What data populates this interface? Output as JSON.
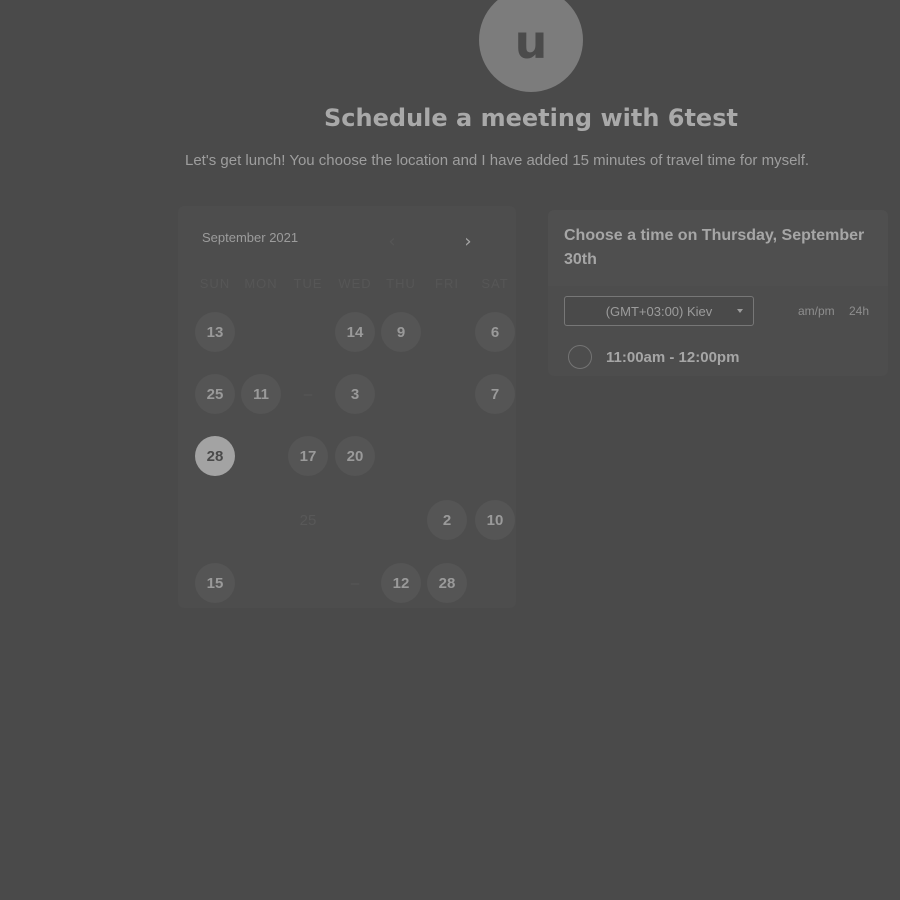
{
  "avatar": {
    "initial": "u"
  },
  "header": {
    "title": "Schedule a meeting with 6test",
    "subtitle": "Let's get lunch! You choose the location and I have added 15 minutes of travel time for myself."
  },
  "calendar": {
    "month_label": "September 2021",
    "prev_icon": "chevron-left-icon",
    "next_icon": "chevron-right-icon",
    "weekdays": [
      "SUN",
      "MON",
      "TUE",
      "WED",
      "THU",
      "FRI",
      "SAT"
    ],
    "days": [
      {
        "label": "13",
        "state": "available",
        "row": 0,
        "col": 0
      },
      {
        "label": "14",
        "state": "available",
        "row": 0,
        "col": 3
      },
      {
        "label": "9",
        "state": "available",
        "row": 0,
        "col": 4
      },
      {
        "label": "6",
        "state": "available",
        "row": 0,
        "col": 6
      },
      {
        "label": "25",
        "state": "available",
        "row": 1,
        "col": 0
      },
      {
        "label": "11",
        "state": "available",
        "row": 1,
        "col": 1
      },
      {
        "label": "–",
        "state": "unavailable",
        "row": 1,
        "col": 2
      },
      {
        "label": "3",
        "state": "available",
        "row": 1,
        "col": 3
      },
      {
        "label": "7",
        "state": "available",
        "row": 1,
        "col": 6
      },
      {
        "label": "28",
        "state": "selected",
        "row": 2,
        "col": 0
      },
      {
        "label": "17",
        "state": "available",
        "row": 2,
        "col": 2
      },
      {
        "label": "20",
        "state": "available",
        "row": 2,
        "col": 3
      },
      {
        "label": "25",
        "state": "unavailable",
        "row": 3,
        "col": 2
      },
      {
        "label": "2",
        "state": "available",
        "row": 3,
        "col": 5
      },
      {
        "label": "10",
        "state": "available",
        "row": 3,
        "col": 6
      },
      {
        "label": "15",
        "state": "available",
        "row": 4,
        "col": 0
      },
      {
        "label": "–",
        "state": "unavailable",
        "row": 4,
        "col": 3
      },
      {
        "label": "12",
        "state": "available",
        "row": 4,
        "col": 4
      },
      {
        "label": "28",
        "state": "available",
        "row": 4,
        "col": 5
      }
    ]
  },
  "times": {
    "heading": "Choose a time on Thursday, September 30th",
    "timezone": "(GMT+03:00) Kiev",
    "format_ampm": "am/pm",
    "format_24h": "24h",
    "slots": [
      {
        "label": "11:00am - 12:00pm"
      }
    ]
  }
}
